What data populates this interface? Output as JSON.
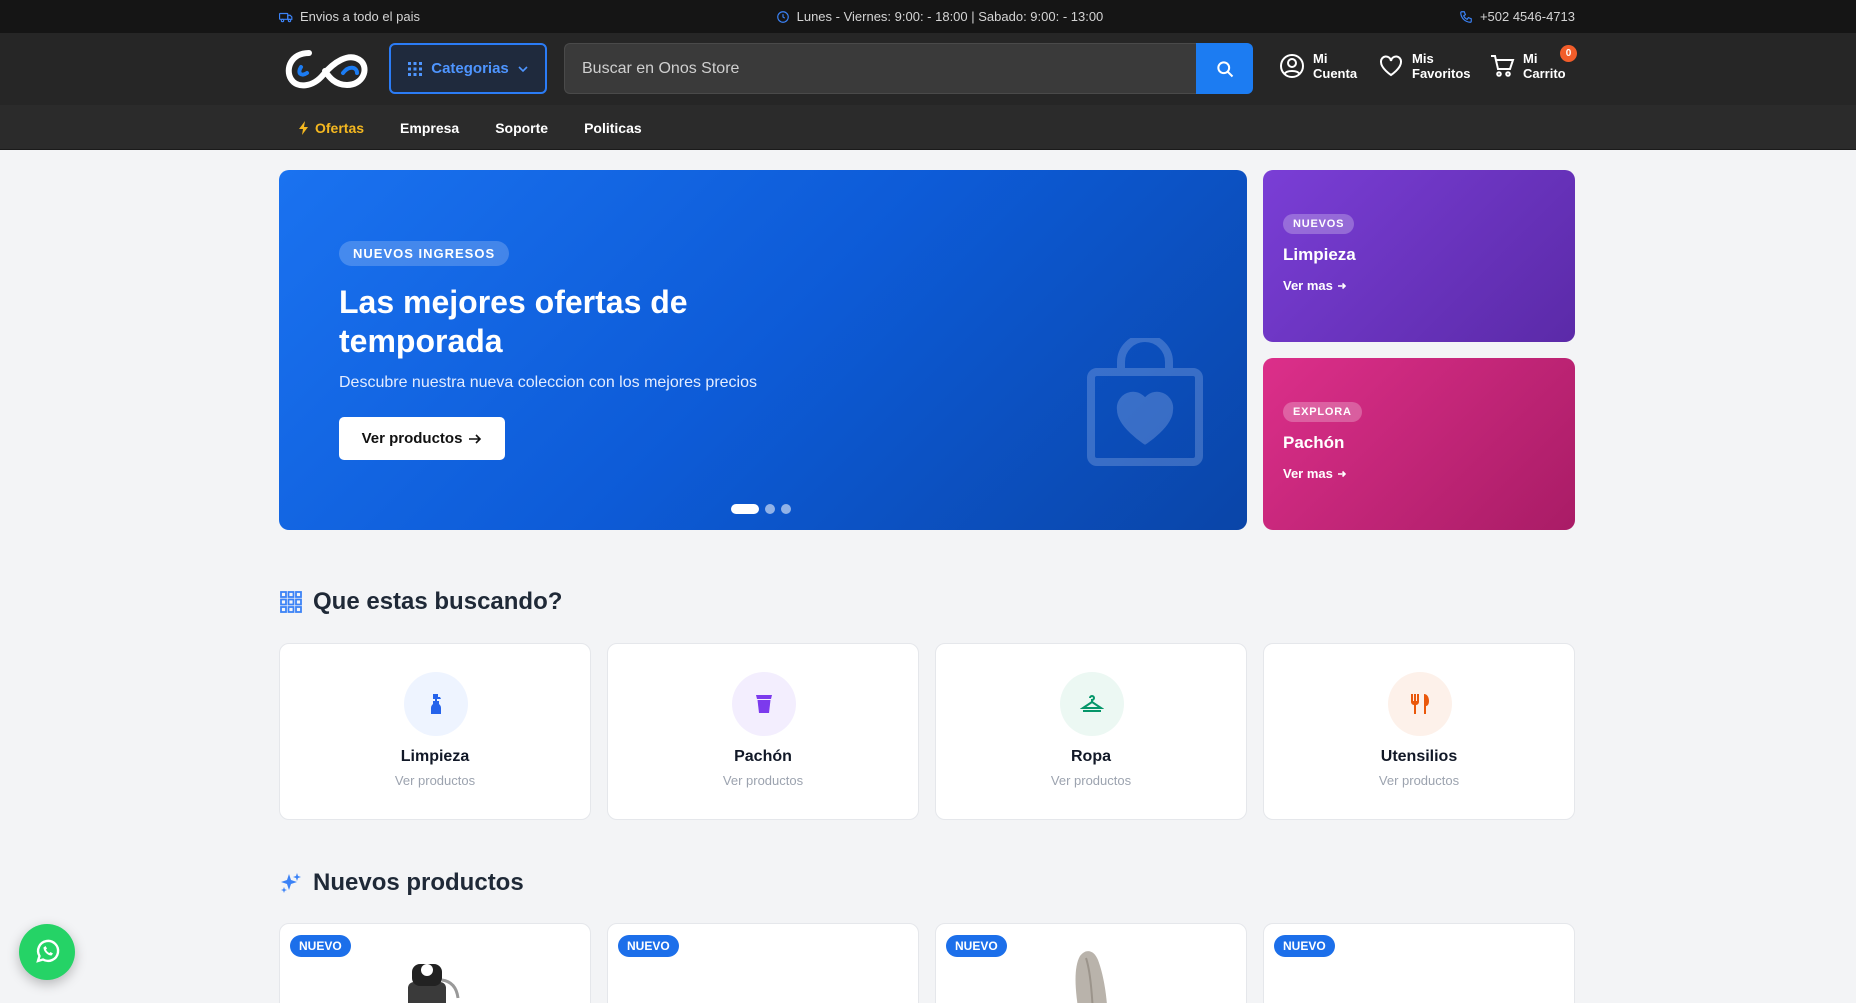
{
  "topbar": {
    "shipping": "Envios a todo el pais",
    "hours": "Lunes - Viernes: 9:00: - 18:00 | Sabado: 9:00: - 13:00",
    "phone": "+502 4546-4713"
  },
  "header": {
    "categories_label": "Categorias",
    "search_placeholder": "Buscar en Onos Store",
    "account": {
      "line1": "Mi",
      "line2": "Cuenta"
    },
    "favorites": {
      "line1": "Mis",
      "line2": "Favoritos"
    },
    "cart": {
      "line1": "Mi",
      "line2": "Carrito",
      "count": "0"
    }
  },
  "nav": {
    "items": [
      {
        "label": "Ofertas"
      },
      {
        "label": "Empresa"
      },
      {
        "label": "Soporte"
      },
      {
        "label": "Politicas"
      }
    ]
  },
  "hero": {
    "tag": "NUEVOS INGRESOS",
    "title": "Las mejores ofertas de temporada",
    "subtitle": "Descubre nuestra nueva coleccion con los mejores precios",
    "cta": "Ver productos",
    "slides": 3,
    "active_slide": 1
  },
  "promos": [
    {
      "tag": "NUEVOS",
      "title": "Limpieza",
      "more": "Ver mas"
    },
    {
      "tag": "EXPLORA",
      "title": "Pachón",
      "more": "Ver mas"
    }
  ],
  "categories_section": {
    "title": "Que estas buscando?",
    "items": [
      {
        "name": "Limpieza",
        "sub": "Ver productos",
        "icon": "spray-bottle-icon",
        "color": "#2563eb",
        "bg": "#eef4ff"
      },
      {
        "name": "Pachón",
        "sub": "Ver productos",
        "icon": "cup-icon",
        "color": "#7c3aed",
        "bg": "#f3eefe"
      },
      {
        "name": "Ropa",
        "sub": "Ver productos",
        "icon": "hanger-icon",
        "color": "#059669",
        "bg": "#ecf8f3"
      },
      {
        "name": "Utensilios",
        "sub": "Ver productos",
        "icon": "utensils-icon",
        "color": "#ea580c",
        "bg": "#fdf1ea"
      }
    ]
  },
  "products_section": {
    "title": "Nuevos productos",
    "items": [
      {
        "badge": "NUEVO"
      },
      {
        "badge": "NUEVO"
      },
      {
        "badge": "NUEVO"
      },
      {
        "badge": "NUEVO"
      }
    ]
  },
  "colors": {
    "accent": "#1c7cf2",
    "offers": "#f5b820",
    "whatsapp": "#25d366"
  }
}
